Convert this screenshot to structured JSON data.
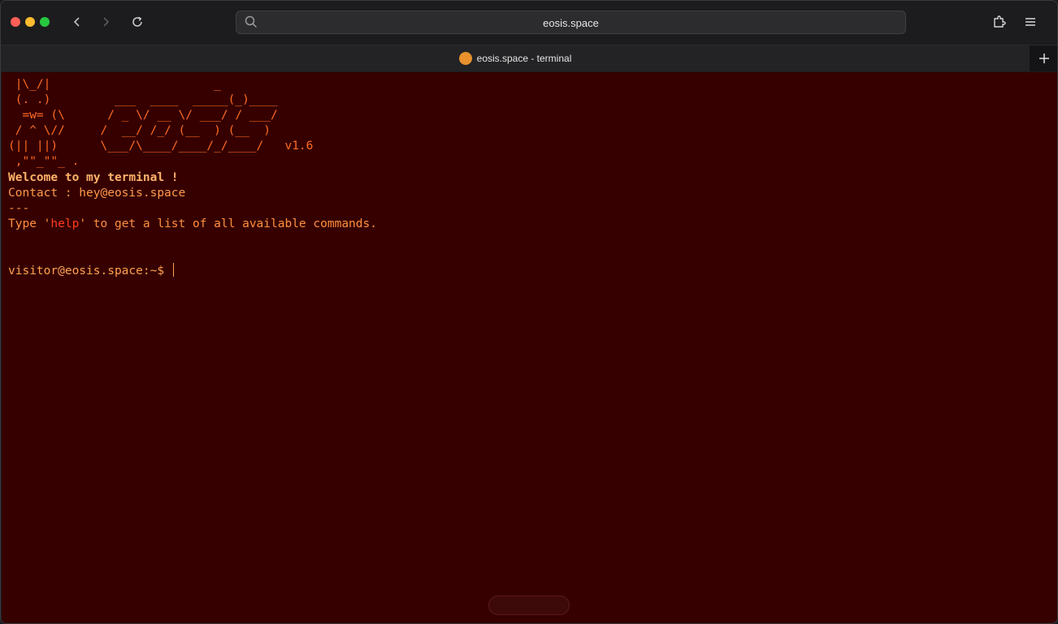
{
  "browser": {
    "url": "eosis.space",
    "tab_title": "eosis.space - terminal",
    "accent_favicon": "#e8912d"
  },
  "icons": {
    "back": "chevron-left-icon",
    "forward": "chevron-right-icon",
    "reload": "reload-icon",
    "search": "search-icon",
    "extensions": "puzzle-icon",
    "menu": "hamburger-menu-icon",
    "new_tab": "plus-icon"
  },
  "terminal": {
    "background": "#360000",
    "ascii_art": [
      " |\\_/|                       _",
      " (. .)         ___  ____  _____(_)____",
      "  =w= (\\      / _ \\/ __ \\/ ___/ / ___/",
      " / ^ \\//     /  __/ /_/ (__  ) (__  )",
      "(|| ||)      \\___/\\____/____/_/____/   ",
      " ,\"\"_\"\"_ ."
    ],
    "version": "v1.6",
    "welcome": "Welcome to my terminal !",
    "contact": "Contact : hey@eosis.space",
    "separator": "---",
    "help_prefix": "Type '",
    "help_command": "help",
    "help_suffix": "' to get a list of all available commands.",
    "prompt": "visitor@eosis.space:~$"
  }
}
